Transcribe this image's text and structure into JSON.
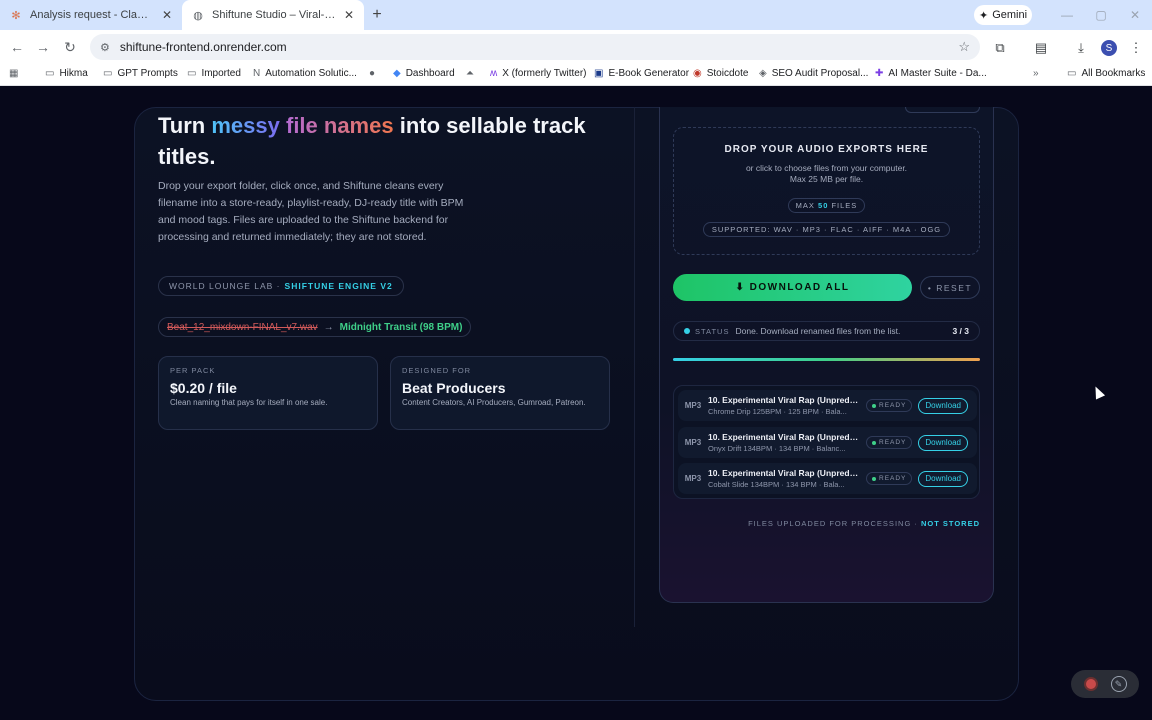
{
  "browser": {
    "tabs": [
      {
        "title": "Analysis request - Claude",
        "icon": "claude-icon"
      },
      {
        "title": "Shiftune Studio – Viral-Ready A",
        "icon": "shiftune-icon"
      }
    ],
    "gemini_label": "Gemini",
    "url": "shiftune-frontend.onrender.com",
    "profile_initial": "S",
    "bookmarks": [
      "Hikma",
      "GPT Prompts",
      "Imported",
      "Automation Solutic...",
      "Dashboard",
      "X (formerly Twitter)",
      "E-Book Generator",
      "Stoicdote",
      "SEO Audit Proposal...",
      "AI Master Suite - Da..."
    ],
    "all_bookmarks": "All Bookmarks"
  },
  "hero": {
    "title_part1": "Turn ",
    "title_hl1": "messy",
    "title_hl2": " file names",
    "title_part2": " into sellable track titles.",
    "description": "Drop your export folder, click once, and Shiftune cleans every filename into a store-ready, playlist-ready, DJ-ready title with BPM and mood tags. Files are uploaded to the Shiftune backend for processing and returned immediately; they are not stored.",
    "brand_prefix": "WORLD LOUNGE LAB ·",
    "brand_engine": "SHIFTUNE ENGINE V2",
    "demo_old": "Beat_12_mixdown-FINAL_v7.wav",
    "demo_arrow": "→",
    "demo_new": "Midnight Transit (98 BPM)"
  },
  "cards": [
    {
      "label": "PER PACK",
      "value": "$0.20 / file",
      "sub": "Clean naming that pays for itself in one sale."
    },
    {
      "label": "DESIGNED FOR",
      "value": "Beat Producers",
      "sub": "Content Creators, AI Producers, Gumroad, Patreon."
    }
  ],
  "dropzone": {
    "title": "DROP YOUR AUDIO EXPORTS HERE",
    "sub_line1": "or click to choose files from your computer.",
    "sub_line2": "Max 25 MB per file.",
    "max_prefix": "MAX",
    "max_count": "50",
    "max_suffix": "FILES",
    "formats": "SUPPORTED: WAV · MP3 · FLAC · AIFF · M4A · OGG"
  },
  "actions": {
    "download_all": "⬇ DOWNLOAD ALL",
    "reset": "• RESET"
  },
  "status": {
    "key": "STATUS",
    "text": "Done. Download renamed files from the list.",
    "count": "3 / 3",
    "progress": 1.0
  },
  "files": [
    {
      "ext": "MP3",
      "name": "10. Experimental Viral Rap (Unpredict...",
      "meta": "Chrome Drip 125BPM · 125 BPM · Bala...",
      "state": "READY",
      "action": "Download"
    },
    {
      "ext": "MP3",
      "name": "10. Experimental Viral Rap (Unpredict...",
      "meta": "Onyx Drift 134BPM · 134 BPM · Balanc...",
      "state": "READY",
      "action": "Download"
    },
    {
      "ext": "MP3",
      "name": "10. Experimental Viral Rap (Unpredict...",
      "meta": "Cobalt Slide 134BPM · 134 BPM · Bala...",
      "state": "READY",
      "action": "Download"
    }
  ],
  "footnote": {
    "prefix": "FILES UPLOADED FOR PROCESSING ·",
    "emph": "NOT STORED"
  },
  "colors": {
    "accent_cyan": "#35d0e6",
    "accent_green": "#1ec466",
    "page_bg": "#07081a"
  }
}
